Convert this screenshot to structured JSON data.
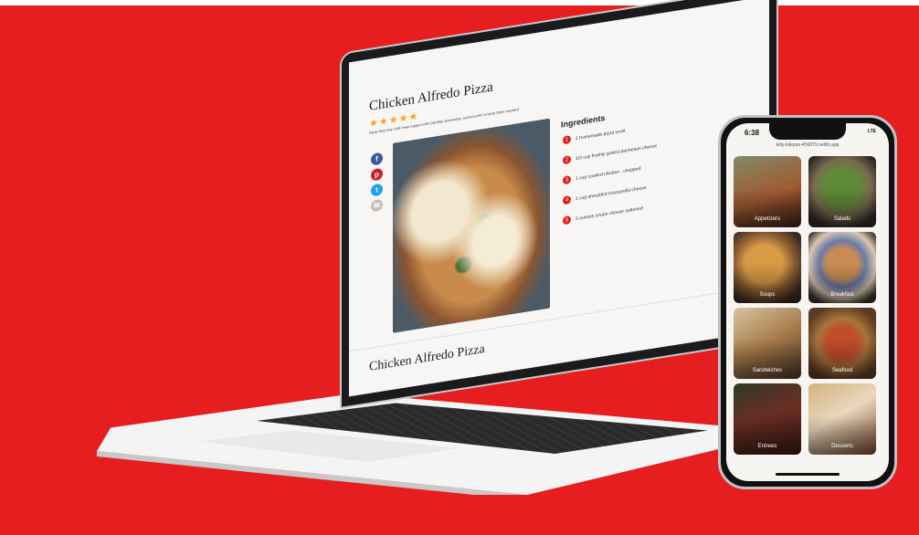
{
  "laptop": {
    "recipe_title": "Chicken Alfredo Pizza",
    "stars": "★★★★★",
    "description": "Deep fried tiny cold meat topped with Old Bay seasoning, served with Lemony Dijon mustard",
    "social_icons": [
      "facebook-icon",
      "pinterest-icon",
      "twitter-icon",
      "email-icon"
    ],
    "ingredients_title": "Ingredients",
    "ingredients": [
      {
        "num": "1",
        "text": "1 homemade pizza crust"
      },
      {
        "num": "2",
        "text": "1/3 cup freshly grated parmesan cheese"
      },
      {
        "num": "3",
        "text": "1 cup cooked chicken , chopped"
      },
      {
        "num": "4",
        "text": "1 cup shredded mozzarella cheese"
      },
      {
        "num": "5",
        "text": "2 ounces cream cheese softened"
      }
    ],
    "recipe_title_repeat": "Chicken Alfredo Pizza"
  },
  "phone": {
    "time": "6:38",
    "signal": "LTE",
    "url": "kitty-kitepan-456879.netlify.app",
    "categories": [
      {
        "label": "Appetizers"
      },
      {
        "label": "Salads"
      },
      {
        "label": "Soups"
      },
      {
        "label": "Breakfast"
      },
      {
        "label": "Sandwiches"
      },
      {
        "label": "Seafood"
      },
      {
        "label": "Entrees"
      },
      {
        "label": "Desserts"
      }
    ]
  },
  "colors": {
    "background": "#e61e1f",
    "accent": "#e21b1b",
    "stars": "#f4a623"
  }
}
